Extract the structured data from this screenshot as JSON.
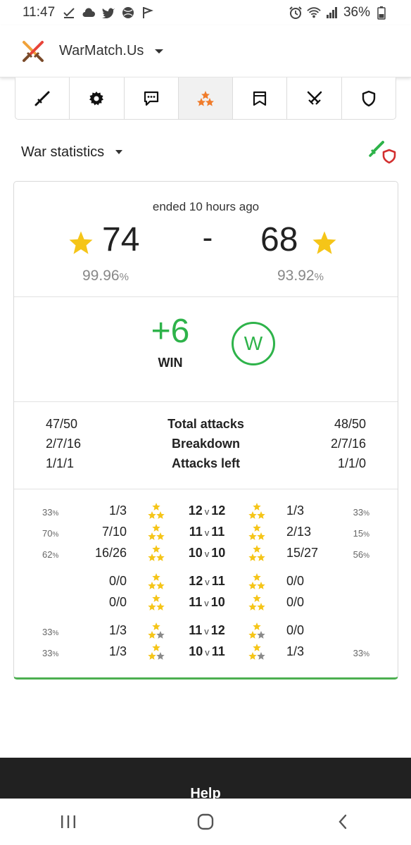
{
  "status_bar": {
    "time": "11:47",
    "battery": "36%"
  },
  "app": {
    "name": "WarMatch.Us"
  },
  "tabs": [
    {
      "icon": "sword-icon",
      "active": false
    },
    {
      "icon": "gear-icon",
      "active": false
    },
    {
      "icon": "chat-icon",
      "active": false
    },
    {
      "icon": "stars-icon",
      "active": true
    },
    {
      "icon": "bookmark-icon",
      "active": false
    },
    {
      "icon": "crossed-swords-icon",
      "active": false
    },
    {
      "icon": "shield-icon",
      "active": false
    }
  ],
  "section": {
    "title": "War statistics"
  },
  "war": {
    "ended": "ended 10 hours ago",
    "our_stars": "74",
    "separator": "-",
    "their_stars": "68",
    "our_destruction": "99.96",
    "their_destruction": "93.92",
    "percent_sign": "%",
    "difference": "+6",
    "result": "WIN",
    "badge": "W"
  },
  "stats": [
    {
      "left": "47/50",
      "label": "Total attacks",
      "right": "48/50"
    },
    {
      "left": "2/7/16",
      "label": "Breakdown",
      "right": "2/7/16"
    },
    {
      "left": "1/1/1",
      "label": "Attacks left",
      "right": "1/1/0"
    }
  ],
  "breakdown_groups": [
    [
      {
        "left_pct": "33",
        "left_frac": "1/3",
        "left_stars": 3,
        "vs_left": "12",
        "vs_right": "12",
        "right_stars": 3,
        "right_frac": "1/3",
        "right_pct": "33"
      },
      {
        "left_pct": "70",
        "left_frac": "7/10",
        "left_stars": 3,
        "vs_left": "11",
        "vs_right": "11",
        "right_stars": 3,
        "right_frac": "2/13",
        "right_pct": "15"
      },
      {
        "left_pct": "62",
        "left_frac": "16/26",
        "left_stars": 3,
        "vs_left": "10",
        "vs_right": "10",
        "right_stars": 3,
        "right_frac": "15/27",
        "right_pct": "56"
      }
    ],
    [
      {
        "left_pct": "",
        "left_frac": "0/0",
        "left_stars": 3,
        "vs_left": "12",
        "vs_right": "11",
        "right_stars": 3,
        "right_frac": "0/0",
        "right_pct": ""
      },
      {
        "left_pct": "",
        "left_frac": "0/0",
        "left_stars": 3,
        "vs_left": "11",
        "vs_right": "10",
        "right_stars": 3,
        "right_frac": "0/0",
        "right_pct": ""
      }
    ],
    [
      {
        "left_pct": "33",
        "left_frac": "1/3",
        "left_stars": 2,
        "vs_left": "11",
        "vs_right": "12",
        "right_stars": 2,
        "right_frac": "0/0",
        "right_pct": ""
      },
      {
        "left_pct": "33",
        "left_frac": "1/3",
        "left_stars": 2,
        "vs_left": "10",
        "vs_right": "11",
        "right_stars": 2,
        "right_frac": "1/3",
        "right_pct": "33"
      }
    ]
  ],
  "vs_word": "v",
  "footer": {
    "help": "Help"
  },
  "colors": {
    "star_gold": "#f5c518",
    "star_gray": "#8a8a8a",
    "win_green": "#2eb34a",
    "tab_star_orange": "#f07b2a"
  }
}
